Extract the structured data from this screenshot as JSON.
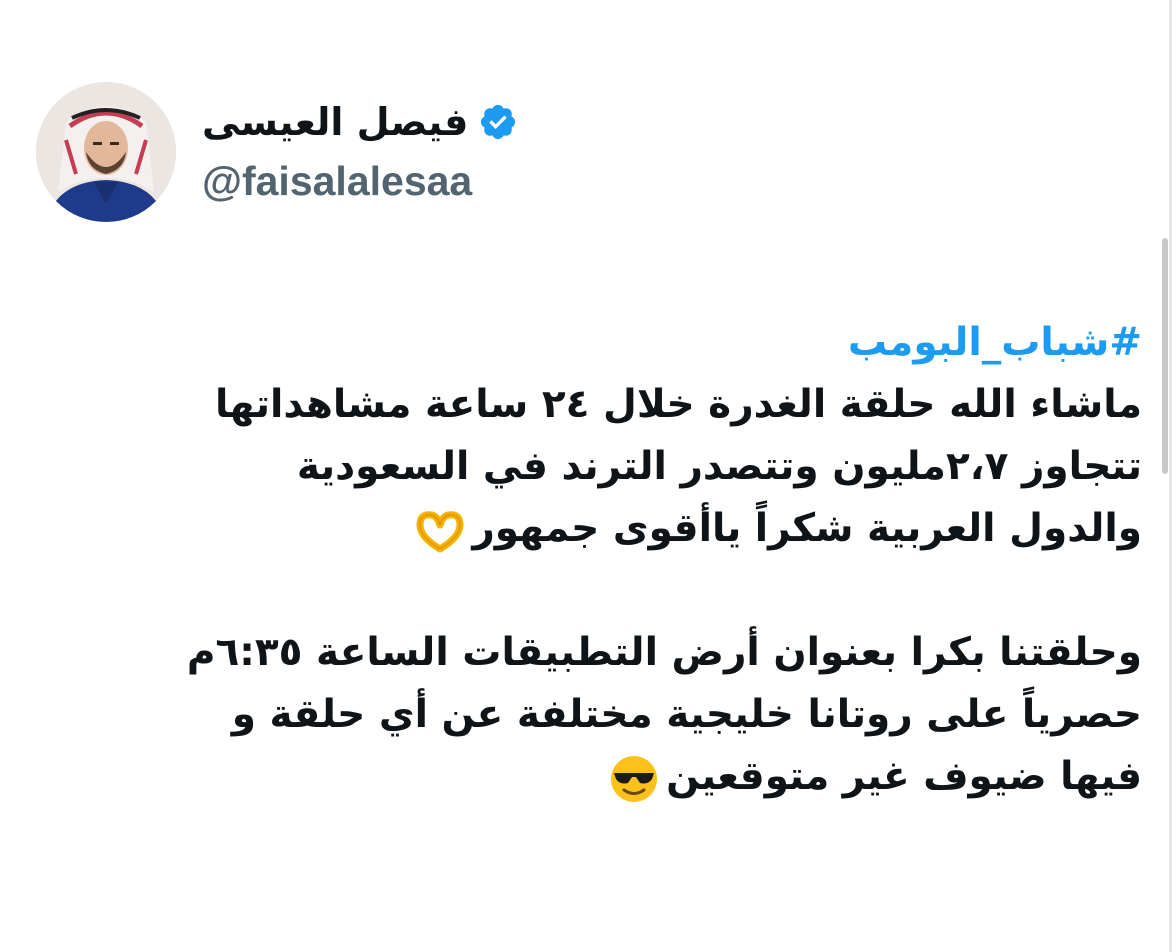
{
  "author": {
    "display_name": "فيصل العيسى",
    "handle": "@faisalalesaa",
    "verified": true,
    "avatar_icon": "profile-photo",
    "verified_icon": "verified-badge-icon",
    "verified_color": "#1d9bf0"
  },
  "tweet": {
    "hashtag": "#شباب_البومب",
    "lines": [
      "ماشاء الله حلقة الغدرة خلال ٢٤ ساعة مشاهداتها",
      "تتجاوز ٢،٧مليون وتتصدر الترند في السعودية",
      "والدول العربية شكراً يا​أقوى جمهور",
      "",
      "وحلقتنا بكرا بعنوان أرض التطبيقات الساعة ٦:٣٥م",
      "حصرياً على روتانا خليجية مختلفة عن أي حلقة و",
      "فيها ضيوف غير متوقعين"
    ],
    "emoji_line3": "heart-hands-emoji",
    "emoji_line7": "sunglasses-emoji",
    "hashtag_color": "#1d9bf0"
  }
}
